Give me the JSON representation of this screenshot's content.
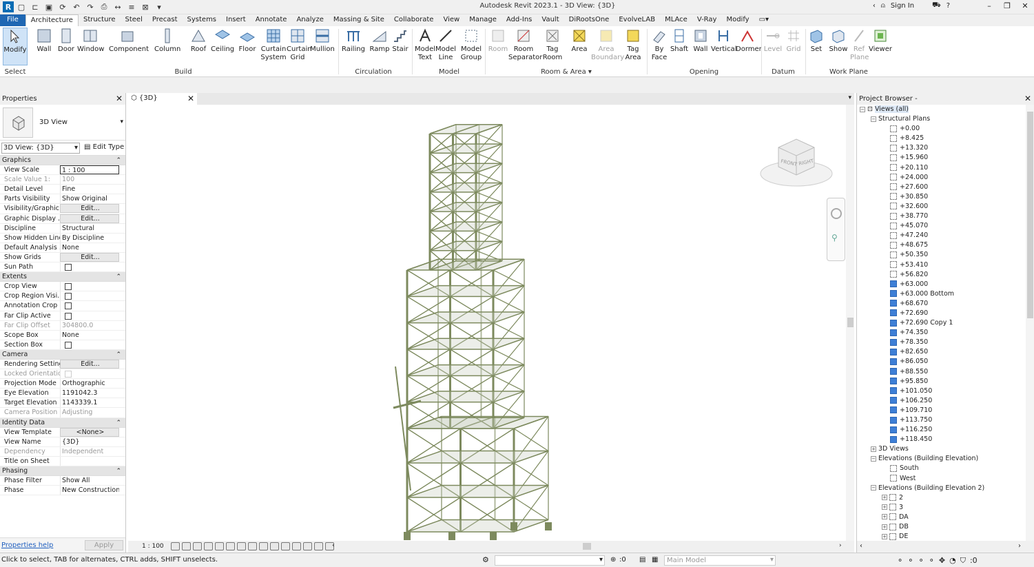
{
  "app": {
    "title": "Autodesk Revit 2023.1 - 3D View: {3D}",
    "sign_in": "Sign In"
  },
  "tabs": [
    "File",
    "Architecture",
    "Structure",
    "Steel",
    "Precast",
    "Systems",
    "Insert",
    "Annotate",
    "Analyze",
    "Massing & Site",
    "Collaborate",
    "View",
    "Manage",
    "Add-Ins",
    "Vault",
    "DiRootsOne",
    "EvolveLAB",
    "MLAce",
    "V-Ray",
    "Modify"
  ],
  "ribbon": {
    "buttons": [
      {
        "label": "Modify",
        "sub": ""
      },
      {
        "label": "Wall",
        "sub": ""
      },
      {
        "label": "Door",
        "sub": ""
      },
      {
        "label": "Window",
        "sub": ""
      },
      {
        "label": "Component",
        "sub": ""
      },
      {
        "label": "Column",
        "sub": ""
      },
      {
        "label": "Roof",
        "sub": ""
      },
      {
        "label": "Ceiling",
        "sub": ""
      },
      {
        "label": "Floor",
        "sub": ""
      },
      {
        "label": "Curtain",
        "sub": "System"
      },
      {
        "label": "Curtain",
        "sub": "Grid"
      },
      {
        "label": "Mullion",
        "sub": ""
      },
      {
        "label": "Railing",
        "sub": ""
      },
      {
        "label": "Ramp",
        "sub": ""
      },
      {
        "label": "Stair",
        "sub": ""
      },
      {
        "label": "Model",
        "sub": "Text"
      },
      {
        "label": "Model",
        "sub": "Line"
      },
      {
        "label": "Model",
        "sub": "Group"
      },
      {
        "label": "Room",
        "sub": ""
      },
      {
        "label": "Room",
        "sub": "Separator"
      },
      {
        "label": "Tag",
        "sub": "Room"
      },
      {
        "label": "Area",
        "sub": ""
      },
      {
        "label": "Area",
        "sub": "Boundary"
      },
      {
        "label": "Tag",
        "sub": "Area"
      },
      {
        "label": "By",
        "sub": "Face"
      },
      {
        "label": "Shaft",
        "sub": ""
      },
      {
        "label": "Wall",
        "sub": ""
      },
      {
        "label": "Vertical",
        "sub": ""
      },
      {
        "label": "Dormer",
        "sub": ""
      },
      {
        "label": "Level",
        "sub": ""
      },
      {
        "label": "Grid",
        "sub": ""
      },
      {
        "label": "Set",
        "sub": ""
      },
      {
        "label": "Show",
        "sub": ""
      },
      {
        "label": "Ref",
        "sub": "Plane"
      },
      {
        "label": "Viewer",
        "sub": ""
      }
    ],
    "panels": [
      "Select",
      "Build",
      "Circulation",
      "Model",
      "Room & Area",
      "Opening",
      "Datum",
      "Work Plane"
    ]
  },
  "properties": {
    "title": "Properties",
    "type_name": "3D View",
    "view_selector": "3D View: {3D}",
    "edit_type": "Edit Type",
    "groups": [
      {
        "name": "Graphics",
        "rows": [
          {
            "k": "View Scale",
            "v": "1 : 100"
          },
          {
            "k": "Scale Value    1:",
            "v": "100"
          },
          {
            "k": "Detail Level",
            "v": "Fine"
          },
          {
            "k": "Parts Visibility",
            "v": "Show Original"
          },
          {
            "k": "Visibility/Graphic...",
            "v": "Edit..."
          },
          {
            "k": "Graphic Display ...",
            "v": "Edit..."
          },
          {
            "k": "Discipline",
            "v": "Structural"
          },
          {
            "k": "Show Hidden Lines",
            "v": "By Discipline"
          },
          {
            "k": "Default Analysis ...",
            "v": "None"
          },
          {
            "k": "Show Grids",
            "v": "Edit..."
          },
          {
            "k": "Sun Path",
            "v": ""
          }
        ]
      },
      {
        "name": "Extents",
        "rows": [
          {
            "k": "Crop View",
            "v": ""
          },
          {
            "k": "Crop Region Visi...",
            "v": ""
          },
          {
            "k": "Annotation Crop",
            "v": ""
          },
          {
            "k": "Far Clip Active",
            "v": ""
          },
          {
            "k": "Far Clip Offset",
            "v": "304800.0"
          },
          {
            "k": "Scope Box",
            "v": "None"
          },
          {
            "k": "Section Box",
            "v": ""
          }
        ]
      },
      {
        "name": "Camera",
        "rows": [
          {
            "k": "Rendering Settings",
            "v": "Edit..."
          },
          {
            "k": "Locked Orientation",
            "v": ""
          },
          {
            "k": "Projection Mode",
            "v": "Orthographic"
          },
          {
            "k": "Eye Elevation",
            "v": "1191042.3"
          },
          {
            "k": "Target Elevation",
            "v": "1143339.1"
          },
          {
            "k": "Camera Position",
            "v": "Adjusting"
          }
        ]
      },
      {
        "name": "Identity Data",
        "rows": [
          {
            "k": "View Template",
            "v": "<None>"
          },
          {
            "k": "View Name",
            "v": "{3D}"
          },
          {
            "k": "Dependency",
            "v": "Independent"
          },
          {
            "k": "Title on Sheet",
            "v": ""
          }
        ]
      },
      {
        "name": "Phasing",
        "rows": [
          {
            "k": "Phase Filter",
            "v": "Show All"
          },
          {
            "k": "Phase",
            "v": "New Construction"
          }
        ]
      }
    ],
    "help": "Properties help",
    "apply": "Apply"
  },
  "view": {
    "tab": "{3D}",
    "scale": "1 : 100",
    "cube_front": "FRONT",
    "cube_right": "RIGHT"
  },
  "browser": {
    "title": "Project Browser -",
    "root": "Views (all)",
    "structural_plans": "Structural Plans",
    "levels": [
      "+0.00",
      "+8.425",
      "+13.320",
      "+15.960",
      "+20.110",
      "+24.000",
      "+27.600",
      "+30.850",
      "+32.600",
      "+38.770",
      "+45.070",
      "+47.240",
      "+48.675",
      "+50.350",
      "+53.410",
      "+56.820",
      "+63.000",
      "+63.000 Bottom",
      "+68.670",
      "+72.690",
      "+72.690 Copy 1",
      "+74.350",
      "+78.350",
      "+82.650",
      "+86.050",
      "+88.550",
      "+95.850",
      "+101.050",
      "+106.250",
      "+109.710",
      "+113.750",
      "+116.250",
      "+118.450"
    ],
    "three_d": "3D Views",
    "elev1": "Elevations (Building Elevation)",
    "elev1_items": [
      "South",
      "West"
    ],
    "elev2": "Elevations (Building Elevation 2)",
    "elev2_items": [
      "2",
      "3",
      "DA",
      "DB",
      "DE"
    ]
  },
  "status": {
    "message": "Click to select, TAB for alternates, CTRL adds, SHIFT unselects.",
    "zero": ":0",
    "model": "Main Model"
  },
  "colors": {
    "file_tab": "#1f67b3",
    "steel": "#7d8a5e",
    "selected_view": "#3e7fd6"
  }
}
